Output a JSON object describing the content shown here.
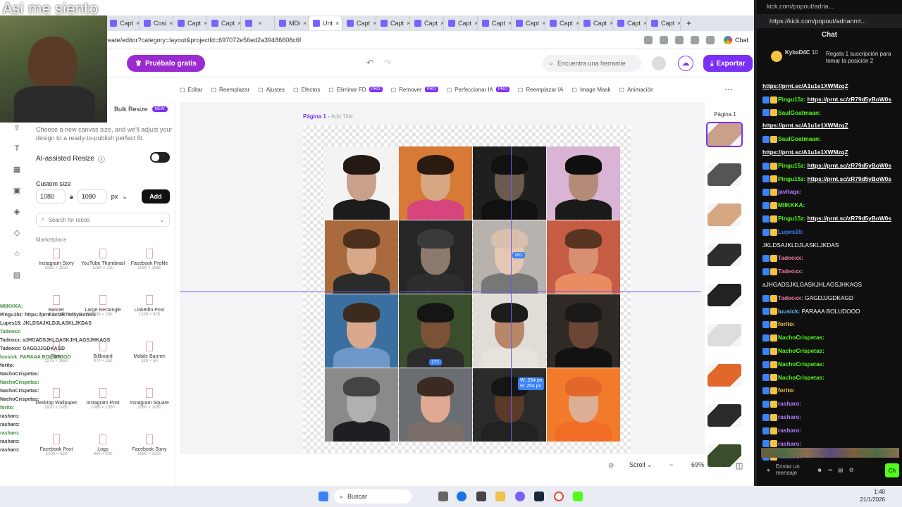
{
  "overlay": {
    "caption": "Asi me siento"
  },
  "browser": {
    "tabs": [
      {
        "label": "Capt"
      },
      {
        "label": "Cosi"
      },
      {
        "label": "Capt"
      },
      {
        "label": "Capt"
      },
      {
        "label": ""
      },
      {
        "label": "MDi"
      },
      {
        "label": "Unt",
        "active": true
      },
      {
        "label": "Capt"
      },
      {
        "label": "Capt"
      },
      {
        "label": "Capt"
      },
      {
        "label": "Capt"
      },
      {
        "label": "Capt"
      },
      {
        "label": "Capt"
      },
      {
        "label": "Capt"
      },
      {
        "label": "Capt"
      },
      {
        "label": "Capt"
      },
      {
        "label": "Capt"
      }
    ],
    "url": "reate/editor?category=layout&projectId=697072e56ed2a39486608c6f",
    "chat_button": "Chat"
  },
  "header": {
    "trial_button": "Pruébalo gratis",
    "search_placeholder": "Encuentra una herramie",
    "export_button": "Exportar"
  },
  "toolbar": {
    "items": [
      {
        "label": "Editar"
      },
      {
        "label": "Reemplazar"
      },
      {
        "label": "Ajustes"
      },
      {
        "label": "Efectos"
      },
      {
        "label": "Eliminar FD",
        "pro": "PRO"
      },
      {
        "label": "Remover",
        "pro": "PRO"
      },
      {
        "label": "Perfeccionar IA",
        "pro": "PRO"
      },
      {
        "label": "Reemplazar IA"
      },
      {
        "label": "Image Mask"
      },
      {
        "label": "Animación"
      }
    ]
  },
  "panel": {
    "bulk_resize": "Bulk Resize",
    "new_badge": "NEW",
    "description": "Choose a new canvas size, and we'll adjust your design to a ready-to-publish perfect fit.",
    "ai_resize": "AI-assisted Resize",
    "custom_size": "Custom size",
    "width": "1080",
    "height": "1080",
    "unit": "px",
    "add_button": "Add",
    "ratio_search": "Search for ratios",
    "marketplace": "Marketplace",
    "presets": [
      {
        "name": "Instagram Story",
        "dims": "1080 × 1920"
      },
      {
        "name": "YouTube Thumbnail",
        "dims": "1280 × 720"
      },
      {
        "name": "Facebook Profile",
        "dims": "1080 × 1080"
      },
      {
        "name": "Banner",
        "dims": "468 × 60"
      },
      {
        "name": "Large Rectangle",
        "dims": "336 × 280"
      },
      {
        "name": "LinkedIn Post",
        "dims": "1200 × 628"
      },
      {
        "name": "Flyer",
        "dims": "1275 × 1650"
      },
      {
        "name": "Billboard",
        "dims": "970 × 250"
      },
      {
        "name": "Mobile Banner",
        "dims": "320 × 50"
      },
      {
        "name": "Desktop Wallpaper",
        "dims": "1920 × 1080"
      },
      {
        "name": "Instagram Post",
        "dims": "1080 × 1350"
      },
      {
        "name": "Instagram Square",
        "dims": "1080 × 1080"
      },
      {
        "name": "Facebook Post",
        "dims": "1200 × 630"
      },
      {
        "name": "Logo",
        "dims": "800 × 800"
      },
      {
        "name": "Facebook Story",
        "dims": "1080 × 1920"
      }
    ]
  },
  "canvas": {
    "page_label": "Página 1",
    "page_title_placeholder": "Add Title",
    "badge_1": "161",
    "badge_2": "171",
    "badge_3": "W: 254 px\nH: 254 px",
    "cells": [
      {
        "bg": "#f3f3f3",
        "skin": "#c9a08a",
        "hair": "#241a14",
        "body": "#1c1c1c"
      },
      {
        "bg": "#d67a35",
        "skin": "#d7a683",
        "hair": "#2a1a10",
        "body": "#d6467c"
      },
      {
        "bg": "#1f1f1f",
        "skin": "#6b5a4d",
        "hair": "#111111",
        "body": "#111111"
      },
      {
        "bg": "#d9b4d4",
        "skin": "#b48a78",
        "hair": "#101010",
        "body": "#1a1a1a"
      },
      {
        "bg": "#a96a3d",
        "skin": "#d8a988",
        "hair": "#4a2f1d",
        "body": "#2b2b2b"
      },
      {
        "bg": "#262626",
        "skin": "#8c7a6e",
        "hair": "#3a3a3a",
        "body": "#2e2e2e"
      },
      {
        "bg": "#b7b2ad",
        "skin": "#e5c8b3",
        "hair": "#d9c0ad",
        "body": "#777777"
      },
      {
        "bg": "#c55c43",
        "skin": "#d98f72",
        "hair": "#5a3423",
        "body": "#ea8c61"
      },
      {
        "bg": "#3a6fa0",
        "skin": "#d9a88d",
        "hair": "#3b2a1d",
        "body": "#6f97c9"
      },
      {
        "bg": "#3a4d2c",
        "skin": "#7a5236",
        "hair": "#151515",
        "body": "#2b2b2b"
      },
      {
        "bg": "#e2dcd6",
        "skin": "#b8876a",
        "hair": "#1c1c1c",
        "body": "#e8e2dd"
      },
      {
        "bg": "#2f2a26",
        "skin": "#6b4634",
        "hair": "#1a1a1a",
        "body": "#121212"
      },
      {
        "bg": "#8a8a8a",
        "skin": "#b0b0b0",
        "hair": "#444444",
        "body": "#1e1e24"
      },
      {
        "bg": "#6a6e72",
        "skin": "#e0a993",
        "hair": "#3b2a22",
        "body": "#7a6f68"
      },
      {
        "bg": "#2b2b2b",
        "skin": "#5b3a2a",
        "hair": "#151515",
        "body": "#222222"
      },
      {
        "bg": "#f27a2b",
        "skin": "#dcae96",
        "hair": "#e2672a",
        "body": "#ef6d24"
      }
    ],
    "scroll_label": "Scroll",
    "zoom": "69%"
  },
  "pages_panel": {
    "title": "Página 1"
  },
  "taskbar": {
    "search": "Buscar",
    "time": "1:40",
    "date": "21/1/2026"
  },
  "kick": {
    "window_title": "kick.com/popout/adria...",
    "url": "https://kick.com/popout/adrianmt...",
    "chat_title": "Chat",
    "sub_user": "KybaD4C",
    "sub_count": "10",
    "sub_text": "Regala 1 suscripción para tomar la posición 2",
    "input_placeholder": "Enviar un mensaje",
    "send": "Ch",
    "messages": [
      {
        "user": "",
        "text": "https://prnt.sc/A1u1e1XWMzqZ",
        "color": "#ffffff",
        "link": true
      },
      {
        "user": "Pingu15z:",
        "text": "https://prnt.sc/zR79d5yBoW0s",
        "color": "#53fc18",
        "link": true
      },
      {
        "user": "SaulGoatmaan:",
        "text": "",
        "color": "#53fc18"
      },
      {
        "user": "",
        "text": "https://prnt.sc/A1u1e1XWMzqZ",
        "color": "#ffffff",
        "link": true
      },
      {
        "user": "SaulGoatmaan:",
        "text": "",
        "color": "#53fc18"
      },
      {
        "user": "",
        "text": "https://prnt.sc/A1u1e1XWMzqZ",
        "color": "#ffffff",
        "link": true
      },
      {
        "user": "Pingu15z:",
        "text": "https://prnt.sc/zR79d5yBoW0s",
        "color": "#53fc18",
        "link": true
      },
      {
        "user": "Pingu15z:",
        "text": "https://prnt.sc/zR79d5yBoW0s",
        "color": "#53fc18",
        "link": true
      },
      {
        "user": "javitagc:",
        "text": "",
        "color": "#b07cff"
      },
      {
        "user": "MIIKKKA:",
        "text": "",
        "color": "#53fc18"
      },
      {
        "user": "Pingu15z:",
        "text": "https://prnt.sc/zR79d5yBoW0s",
        "color": "#53fc18",
        "link": true
      },
      {
        "user": "Lupes16:",
        "text": "",
        "color": "#3b82f6"
      },
      {
        "user": "",
        "text": "JKLDSAJKLDJLASKLJKDAS",
        "color": "#ffffff"
      },
      {
        "user": "Tadeoxx:",
        "text": "",
        "color": "#e879a6"
      },
      {
        "user": "Tadeoxx:",
        "text": "",
        "color": "#e879a6"
      },
      {
        "user": "",
        "text": "aJHGADSJKLGASKJHLAGSJHKAGS",
        "color": "#ffffff"
      },
      {
        "user": "Tadeoxx:",
        "text": "GAGDJJGDKAGD",
        "color": "#e879a6"
      },
      {
        "user": "luusick:",
        "text": "PARAAA BOLUDOOO",
        "color": "#5bc0eb"
      },
      {
        "user": "forito:",
        "text": "",
        "color": "#f5c242"
      },
      {
        "user": "NachoCrispetas:",
        "text": "",
        "color": "#53fc18"
      },
      {
        "user": "NachoCrispetas:",
        "text": "",
        "color": "#53fc18"
      },
      {
        "user": "NachoCrispetas:",
        "text": "",
        "color": "#53fc18"
      },
      {
        "user": "NachoCrispetas:",
        "text": "",
        "color": "#53fc18"
      },
      {
        "user": "forito:",
        "text": "",
        "color": "#f5c242"
      },
      {
        "user": "rasharo:",
        "text": "",
        "color": "#b07cff"
      },
      {
        "user": "rasharo:",
        "text": "",
        "color": "#b07cff"
      },
      {
        "user": "rasharo:",
        "text": "",
        "color": "#b07cff"
      },
      {
        "user": "rasharo:",
        "text": "",
        "color": "#b07cff"
      },
      {
        "user": "rasharo:",
        "text": "",
        "color": "#b07cff"
      }
    ]
  },
  "chat_overlay": {
    "lines": [
      "MIIKKKA:",
      "Pingu15z: https://prnt.sc/zR79d5yBoW0s",
      "Lupes16: JKLDSAJKLDJLASKLJKDAS",
      "Tadeoxx:",
      "Tadeoxx: aJHGADSJKLGASKJHLAGSJHKAGS",
      "Tadeoxx: GAGDJJGDKAGD",
      "luusick: PARAAA BOLUDOOO",
      "forito:",
      "NachoCrispetas:",
      "NachoCrispetas:",
      "NachoCrispetas:",
      "NachoCrispetas:",
      "forito:",
      "rasharo:",
      "rasharo:",
      "rasharo:",
      "rasharo:",
      "rasharo:"
    ]
  }
}
